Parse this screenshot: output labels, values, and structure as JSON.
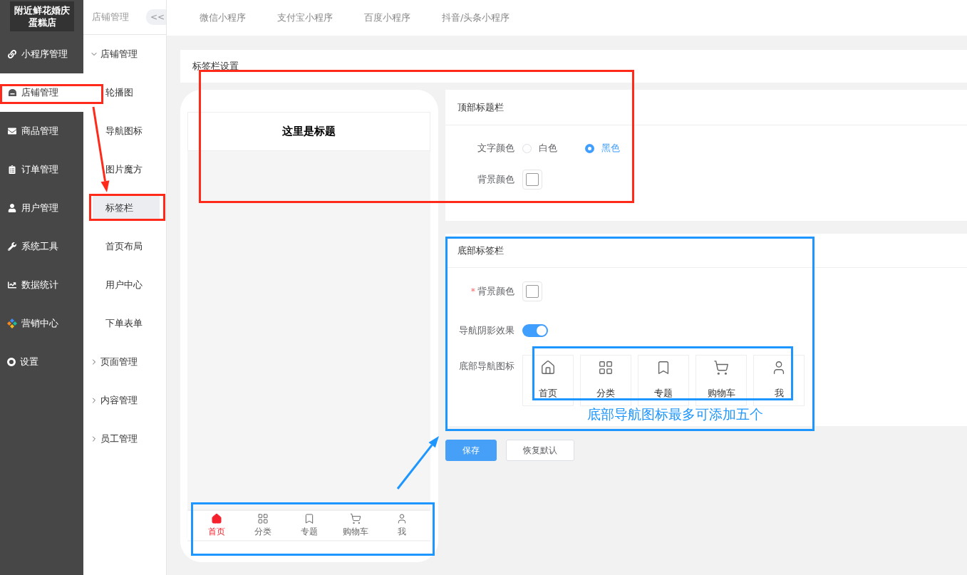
{
  "sidebar": {
    "logo": "附近鲜花婚庆蛋糕店",
    "items": [
      {
        "label": "小程序管理",
        "selected": false
      },
      {
        "label": "店铺管理",
        "selected": true
      },
      {
        "label": "商品管理",
        "selected": false
      },
      {
        "label": "订单管理",
        "selected": false
      },
      {
        "label": "用户管理",
        "selected": false
      },
      {
        "label": "系统工具",
        "selected": false
      },
      {
        "label": "数据统计",
        "selected": false
      },
      {
        "label": "营销中心",
        "selected": false
      },
      {
        "label": "设置",
        "selected": false
      }
    ]
  },
  "submenu": {
    "title": "店铺管理",
    "collapse_button": "<<",
    "groups": [
      {
        "label": "店铺管理",
        "expanded": true,
        "children": [
          {
            "label": "轮播图",
            "selected": false
          },
          {
            "label": "导航图标",
            "selected": false
          },
          {
            "label": "图片魔方",
            "selected": false
          },
          {
            "label": "标签栏",
            "selected": true
          },
          {
            "label": "首页布局",
            "selected": false
          },
          {
            "label": "用户中心",
            "selected": false
          },
          {
            "label": "下单表单",
            "selected": false
          }
        ]
      },
      {
        "label": "页面管理",
        "expanded": false
      },
      {
        "label": "内容管理",
        "expanded": false
      },
      {
        "label": "员工管理",
        "expanded": false
      }
    ]
  },
  "platform_tabs": [
    "微信小程序",
    "支付宝小程序",
    "百度小程序",
    "抖音/头条小程序"
  ],
  "settings_title": "标签栏设置",
  "phone_preview": {
    "title": "这里是标题",
    "tabs": [
      {
        "label": "首页",
        "selected": true
      },
      {
        "label": "分类",
        "selected": false
      },
      {
        "label": "专题",
        "selected": false
      },
      {
        "label": "购物车",
        "selected": false
      },
      {
        "label": "我",
        "selected": false
      }
    ]
  },
  "top_bar_section": {
    "title": "顶部标题栏",
    "text_color": {
      "label": "文字颜色",
      "options": [
        {
          "label": "白色",
          "selected": false
        },
        {
          "label": "黑色",
          "selected": true
        }
      ]
    },
    "background_color": {
      "label": "背景颜色",
      "color": "#ffffff"
    }
  },
  "bottom_bar_section": {
    "title": "底部标签栏",
    "background_color": {
      "label": "背景颜色",
      "required_mark": "*",
      "color": "#ffffff"
    },
    "shadow": {
      "label": "导航阴影效果",
      "on": true
    },
    "nav_icons": {
      "label": "底部导航图标",
      "items": [
        "首页",
        "分类",
        "专题",
        "购物车",
        "我"
      ]
    }
  },
  "buttons": [
    {
      "label": "保存",
      "kind": "primary"
    },
    {
      "label": "恢复默认",
      "kind": "default"
    }
  ],
  "annotations": [
    {
      "kind": "frame",
      "color": "#ff2a1a"
    },
    {
      "kind": "arrow",
      "color": "#ff2a1a"
    },
    {
      "kind": "frame",
      "color": "#ff2a1a"
    },
    {
      "kind": "frame",
      "color": "#ff2a1a"
    },
    {
      "kind": "frame",
      "color": "#1e96ff"
    },
    {
      "kind": "frame",
      "color": "#1e96ff"
    },
    {
      "kind": "note",
      "color": "#1e96ff",
      "text": "底部导航图标最多可添加五个"
    },
    {
      "kind": "arrow",
      "color": "#1e96ff"
    },
    {
      "kind": "frame",
      "color": "#1e96ff"
    }
  ]
}
